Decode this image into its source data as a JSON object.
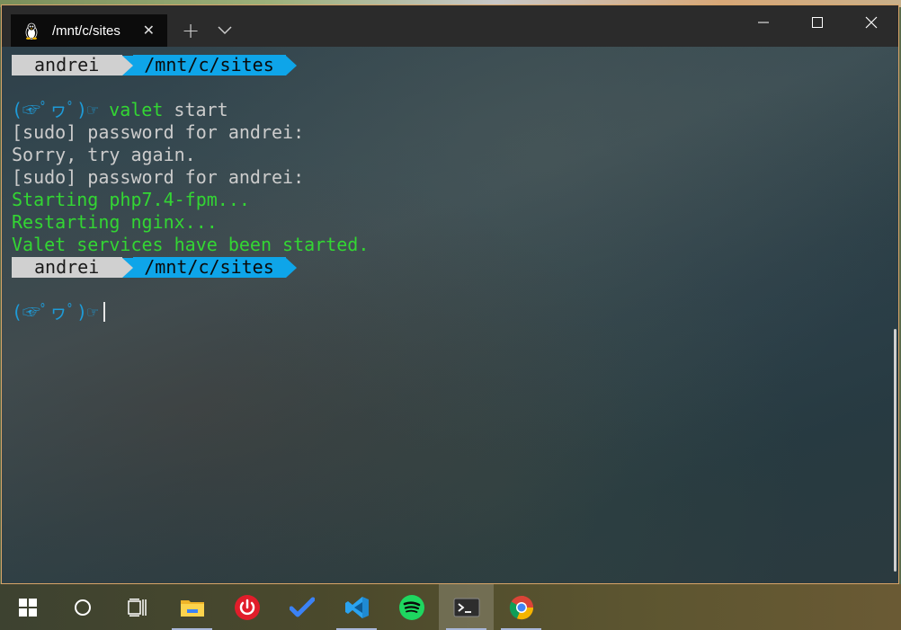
{
  "window": {
    "tab_title": "/mnt/c/sites",
    "tab_close": "✕",
    "new_tab": "+"
  },
  "terminal": {
    "prompt_user": "andrei",
    "prompt_path": "/mnt/c/sites",
    "prompt_face": "(☞ﾟヮﾟ)☞",
    "command": "valet",
    "command_args": " start",
    "output": [
      {
        "text": "[sudo] password for andrei:",
        "color": "white"
      },
      {
        "text": "Sorry, try again.",
        "color": "white"
      },
      {
        "text": "[sudo] password for andrei:",
        "color": "white"
      },
      {
        "text": "Starting php7.4-fpm...",
        "color": "green"
      },
      {
        "text": "Restarting nginx...",
        "color": "green"
      },
      {
        "text": "Valet services have been started.",
        "color": "green"
      }
    ]
  },
  "taskbar": {
    "items": [
      {
        "name": "start-button",
        "icon": "windows-logo-icon"
      },
      {
        "name": "search-button",
        "icon": "cortana-circle-icon"
      },
      {
        "name": "task-view-button",
        "icon": "task-view-icon"
      },
      {
        "name": "file-explorer",
        "icon": "folder-icon"
      },
      {
        "name": "power-app",
        "icon": "power-icon"
      },
      {
        "name": "todo-app",
        "icon": "checkmark-icon"
      },
      {
        "name": "vscode-app",
        "icon": "vscode-icon"
      },
      {
        "name": "spotify-app",
        "icon": "spotify-icon"
      },
      {
        "name": "terminal-app",
        "icon": "terminal-icon"
      },
      {
        "name": "chrome-app",
        "icon": "chrome-icon"
      }
    ]
  },
  "colors": {
    "green": "#33d633",
    "blue_face": "#1e9bd8",
    "path_segment": "#0ea5e9",
    "user_segment": "#d0d0d0"
  }
}
